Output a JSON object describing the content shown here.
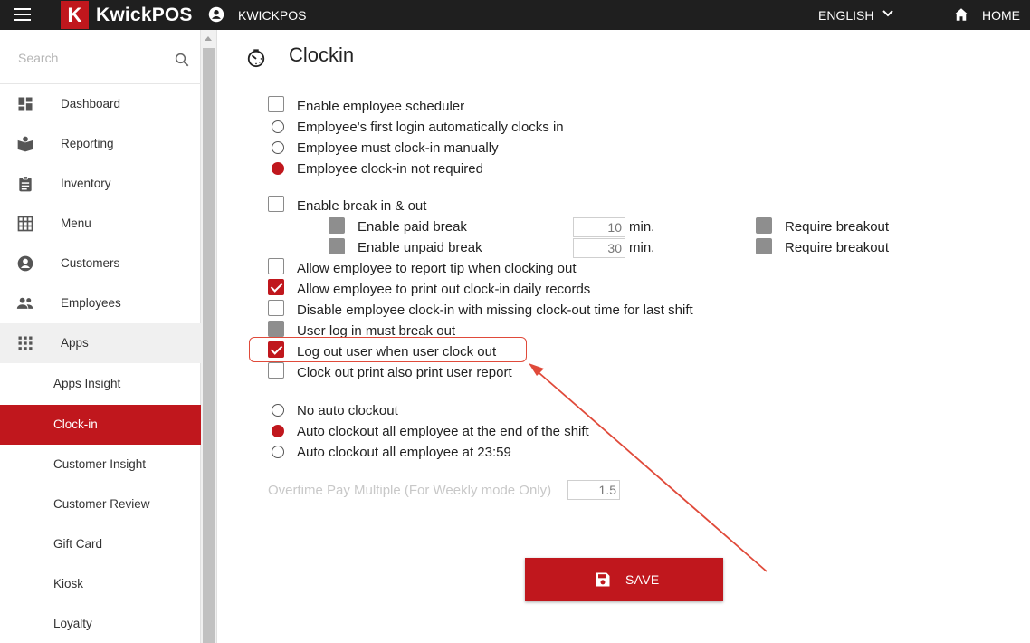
{
  "header": {
    "logo_letter": "K",
    "brand": "KwickPOS",
    "user_name": "KWICKPOS",
    "language": "ENGLISH",
    "home_label": "HOME"
  },
  "sidebar": {
    "search_placeholder": "Search",
    "items": [
      {
        "label": "Dashboard",
        "icon": "dashboard-icon"
      },
      {
        "label": "Reporting",
        "icon": "reporting-icon"
      },
      {
        "label": "Inventory",
        "icon": "clipboard-icon"
      },
      {
        "label": "Menu",
        "icon": "grid-icon"
      },
      {
        "label": "Customers",
        "icon": "account-circle-icon"
      },
      {
        "label": "Employees",
        "icon": "people-icon"
      },
      {
        "label": "Apps",
        "icon": "apps-icon"
      }
    ],
    "sub_items": [
      {
        "label": "Apps Insight"
      },
      {
        "label": "Clock-in",
        "active": true
      },
      {
        "label": "Customer Insight"
      },
      {
        "label": "Customer Review"
      },
      {
        "label": "Gift Card"
      },
      {
        "label": "Kiosk"
      },
      {
        "label": "Loyalty"
      }
    ]
  },
  "main": {
    "title": "Clockin",
    "enable_scheduler": {
      "label": "Enable employee scheduler",
      "checked": false
    },
    "clockin_mode": {
      "options": [
        "Employee's first login automatically clocks in",
        "Employee must clock-in manually",
        "Employee clock-in not required"
      ],
      "selected": 2
    },
    "break": {
      "label": "Enable break in & out",
      "checked": false,
      "paid": {
        "label": "Enable paid break",
        "minutes": "10",
        "unit": "min.",
        "require_label": "Require breakout"
      },
      "unpaid": {
        "label": "Enable unpaid break",
        "minutes": "30",
        "unit": "min.",
        "require_label": "Require breakout"
      }
    },
    "options": [
      {
        "label": "Allow employee to report tip when clocking out",
        "state": "unchecked"
      },
      {
        "label": "Allow employee to print out clock-in daily records",
        "state": "checked"
      },
      {
        "label": "Disable employee clock-in with missing clock-out time for last shift",
        "state": "unchecked"
      },
      {
        "label": "User log in must break out",
        "state": "disabled"
      },
      {
        "label": "Log out user when user clock out",
        "state": "checked"
      },
      {
        "label": "Clock out print also print user report",
        "state": "unchecked"
      }
    ],
    "auto_clockout": {
      "options": [
        "No auto clockout",
        "Auto clockout all employee at the end of the shift",
        "Auto clockout all employee at 23:59"
      ],
      "selected": 1
    },
    "overtime": {
      "label": "Overtime Pay Multiple (For Weekly mode Only)",
      "value": "1.5"
    },
    "save_label": "SAVE"
  },
  "colors": {
    "accent": "#c0171d",
    "topbar": "#1f1f1f",
    "annotation": "#e04a3a"
  }
}
